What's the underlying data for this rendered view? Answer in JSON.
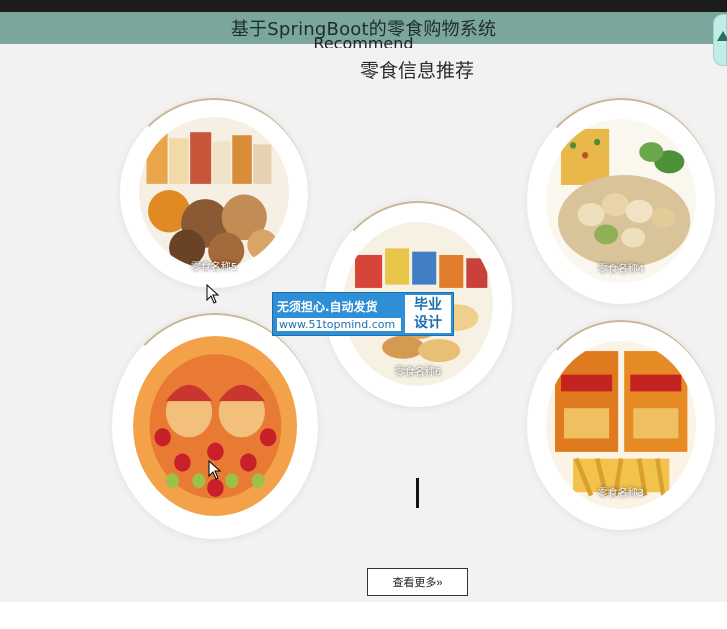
{
  "header": {
    "title": "基于SpringBoot的零食购物系统"
  },
  "section": {
    "title_en": "Recommend",
    "title_zh": "零食信息推荐"
  },
  "products": [
    {
      "label": "零食名称5",
      "theme": "assorted-snacks"
    },
    {
      "label": "零食名称4",
      "theme": "pistachios"
    },
    {
      "label": "零食名称6",
      "theme": "biscuits"
    },
    {
      "label": "",
      "theme": "fruit-platter"
    },
    {
      "label": "零食名称3",
      "theme": "shrimp-chips"
    }
  ],
  "watermark": {
    "line1": "无须担心.自动发货",
    "url": "www.51topmind.com",
    "badge_line1": "毕业",
    "badge_line2": "设计"
  },
  "buttons": {
    "view_more": "查看更多»"
  },
  "colors": {
    "titlebar": "#7aa69e",
    "background": "#f2f2f2",
    "watermark_blue": "#2f8fd6"
  }
}
